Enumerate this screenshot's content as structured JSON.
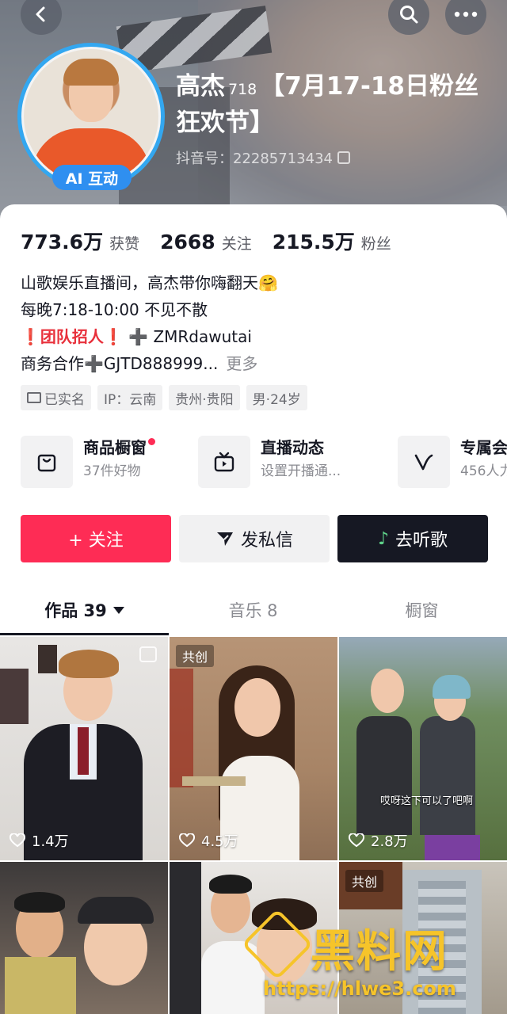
{
  "profile": {
    "nickname": "高杰",
    "nickname_sup": "718",
    "nickname_suffix": "【7月17-18日粉丝狂欢节】",
    "douyin_id": "抖音号：22285713434",
    "ai_badge": "AI 互动"
  },
  "stats": [
    {
      "value": "773.6万",
      "label": "获赞"
    },
    {
      "value": "2668",
      "label": "关注"
    },
    {
      "value": "215.5万",
      "label": "粉丝"
    }
  ],
  "bio": {
    "line1": "山歌娱乐直播间，高杰带你嗨翻天🤗",
    "line2": "每晚7:18-10:00 不见不散",
    "line3_prefix": "❗团队招人❗",
    "line3_plus": "➕",
    "line3_value": "ZMRdawutai",
    "line4": "商务合作➕GJTD888999...",
    "more": "更多"
  },
  "tags": [
    "已实名",
    "IP：云南",
    "贵州·贵阳",
    "男·24岁"
  ],
  "entries": [
    {
      "title": "商品橱窗",
      "sub": "37件好物",
      "icon": "shopping-bag-icon"
    },
    {
      "title": "直播动态",
      "sub": "设置开播通...",
      "icon": "tv-icon"
    },
    {
      "title": "专属会",
      "sub": "456人力",
      "icon": "v-badge-icon"
    }
  ],
  "actions": {
    "follow": "+ 关注",
    "message": "发私信",
    "music": "去听歌"
  },
  "tabs": [
    {
      "label": "作品 39"
    },
    {
      "label": "音乐 8"
    },
    {
      "label": "橱窗"
    }
  ],
  "videos": [
    {
      "likes": "1.4万",
      "co": ""
    },
    {
      "likes": "4.5万",
      "co": "共创"
    },
    {
      "likes": "2.8万",
      "co": "",
      "caption": "哎呀这下可以了吧啊"
    },
    {
      "likes": "",
      "co": ""
    },
    {
      "likes": "",
      "co": ""
    },
    {
      "likes": "",
      "co": "共创"
    }
  ],
  "watermark": {
    "brand": "黑料网",
    "url": "https://hlwe3.com"
  },
  "colors": {
    "accent": "#fe2c55",
    "ai_badge": "#2f8ff0",
    "avatar_ring": "#33a7f0",
    "dark_button": "#161823"
  }
}
